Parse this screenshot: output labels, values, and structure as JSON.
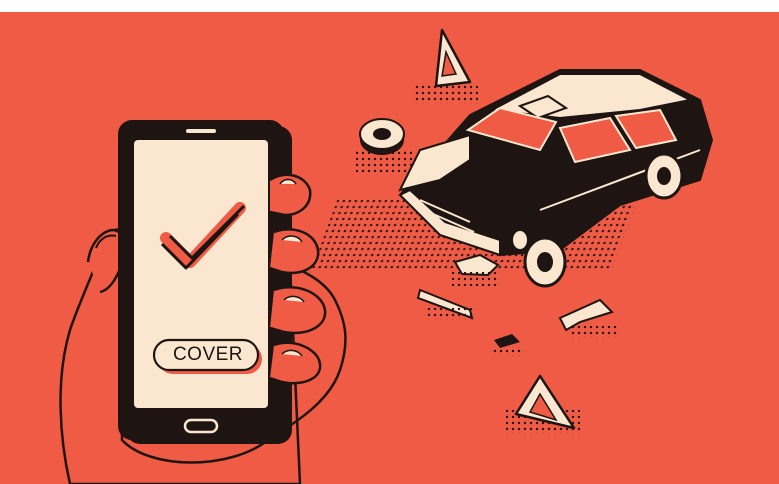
{
  "illustration": {
    "background_color": "#ef5b45",
    "ink_color": "#1e1512",
    "cream_color": "#fbe7cf",
    "phone": {
      "button_label": "COVER",
      "icons": [
        "checkmark-icon",
        "home-button-icon"
      ]
    },
    "scene_items": [
      "warning-triangle-icon",
      "car-wreck",
      "loose-wheel",
      "debris-shard"
    ]
  }
}
